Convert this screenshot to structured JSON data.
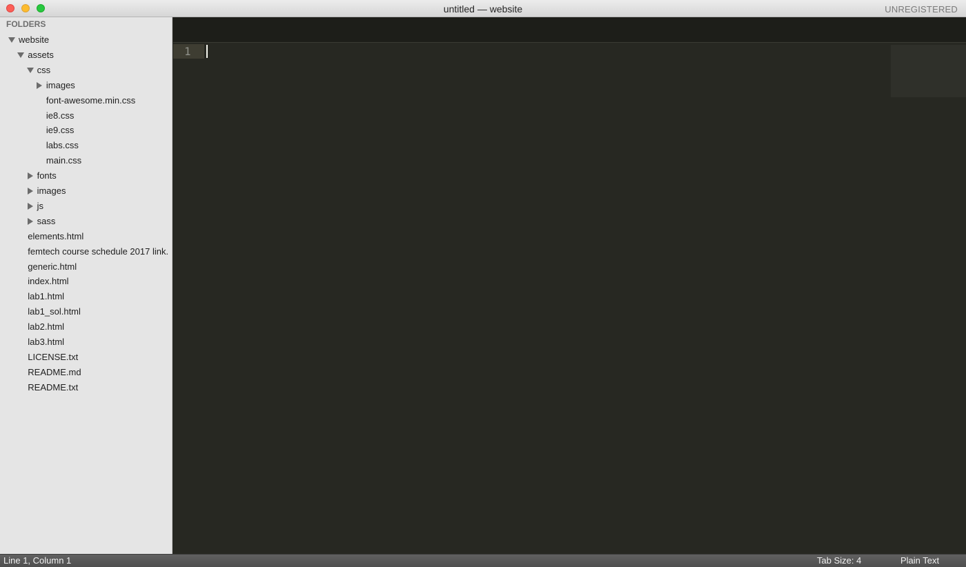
{
  "window": {
    "title": "untitled — website",
    "license_status": "UNREGISTERED"
  },
  "sidebar": {
    "header": "FOLDERS",
    "tree": [
      {
        "label": "website",
        "indent": 0,
        "arrow": "down"
      },
      {
        "label": "assets",
        "indent": 1,
        "arrow": "down"
      },
      {
        "label": "css",
        "indent": 2,
        "arrow": "down"
      },
      {
        "label": "images",
        "indent": 3,
        "arrow": "right"
      },
      {
        "label": "font-awesome.min.css",
        "indent": 3,
        "arrow": "none"
      },
      {
        "label": "ie8.css",
        "indent": 3,
        "arrow": "none"
      },
      {
        "label": "ie9.css",
        "indent": 3,
        "arrow": "none"
      },
      {
        "label": "labs.css",
        "indent": 3,
        "arrow": "none"
      },
      {
        "label": "main.css",
        "indent": 3,
        "arrow": "none"
      },
      {
        "label": "fonts",
        "indent": 2,
        "arrow": "right"
      },
      {
        "label": "images",
        "indent": 2,
        "arrow": "right"
      },
      {
        "label": "js",
        "indent": 2,
        "arrow": "right"
      },
      {
        "label": "sass",
        "indent": 2,
        "arrow": "right"
      },
      {
        "label": "elements.html",
        "indent": 1,
        "arrow": "none"
      },
      {
        "label": "femtech course schedule 2017 link.",
        "indent": 1,
        "arrow": "none"
      },
      {
        "label": "generic.html",
        "indent": 1,
        "arrow": "none"
      },
      {
        "label": "index.html",
        "indent": 1,
        "arrow": "none"
      },
      {
        "label": "lab1.html",
        "indent": 1,
        "arrow": "none"
      },
      {
        "label": "lab1_sol.html",
        "indent": 1,
        "arrow": "none"
      },
      {
        "label": "lab2.html",
        "indent": 1,
        "arrow": "none"
      },
      {
        "label": "lab3.html",
        "indent": 1,
        "arrow": "none"
      },
      {
        "label": "LICENSE.txt",
        "indent": 1,
        "arrow": "none"
      },
      {
        "label": "README.md",
        "indent": 1,
        "arrow": "none"
      },
      {
        "label": "README.txt",
        "indent": 1,
        "arrow": "none"
      }
    ]
  },
  "editor": {
    "line_number": "1",
    "content": ""
  },
  "statusbar": {
    "position": "Line 1, Column 1",
    "tab_size": "Tab Size: 4",
    "syntax": "Plain Text"
  },
  "colors": {
    "editor_bg": "#272822",
    "sidebar_bg": "#e5e5e5",
    "tabbar_bg": "#1d1e19"
  }
}
